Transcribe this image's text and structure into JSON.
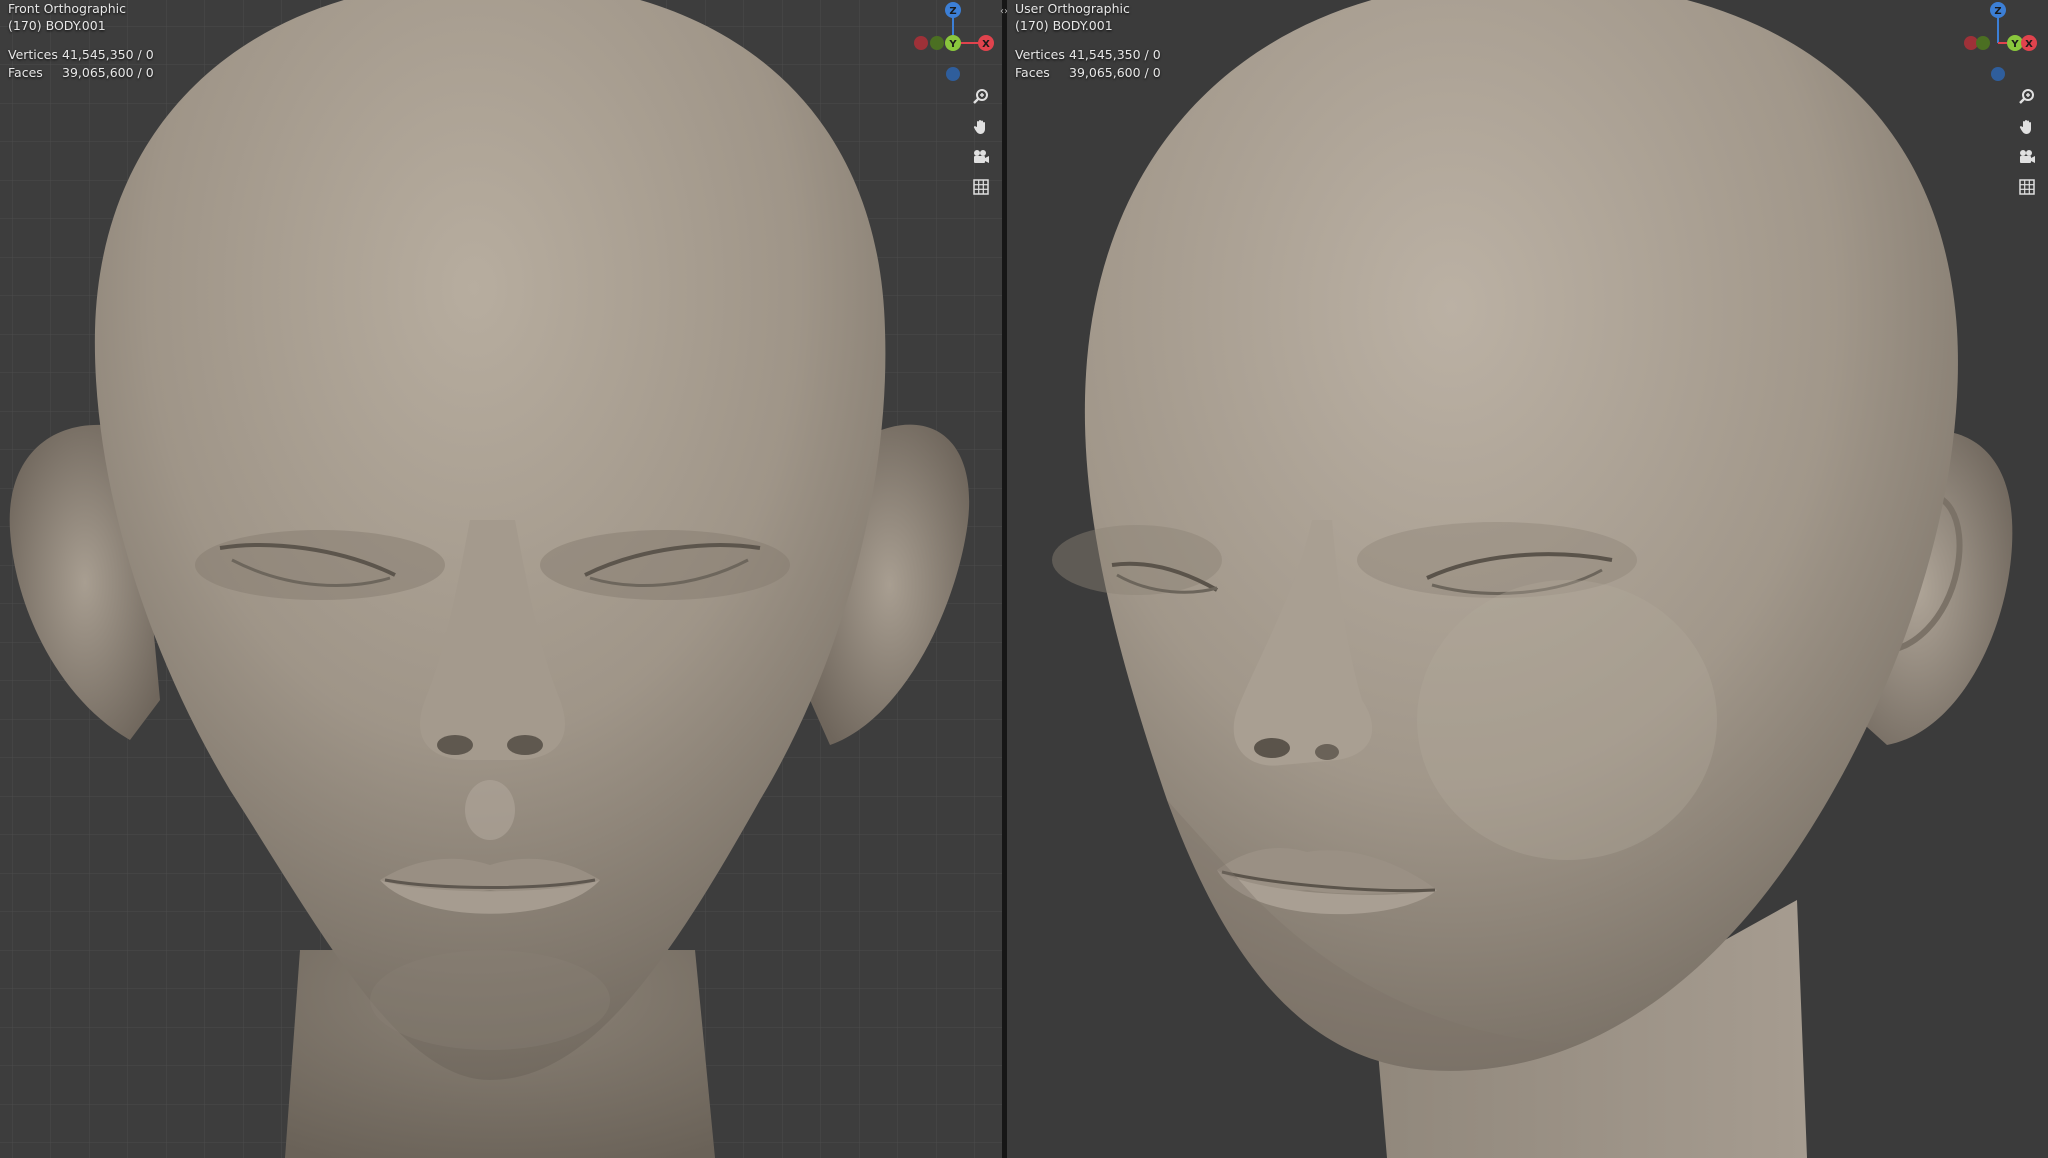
{
  "viewports": {
    "left": {
      "view_name": "Front Orthographic",
      "object_name": "(170) BODY.001",
      "stats": [
        {
          "label": "Vertices",
          "value": "41,545,350 / 0"
        },
        {
          "label": "Faces",
          "value": "39,065,600 / 0"
        }
      ],
      "gizmo_labels": {
        "z": "Z",
        "y": "Y",
        "x": "X"
      }
    },
    "right": {
      "view_name": "User Orthographic",
      "object_name": "(170) BODY.001",
      "stats": [
        {
          "label": "Vertices",
          "value": "41,545,350 / 0"
        },
        {
          "label": "Faces",
          "value": "39,065,600 / 0"
        }
      ],
      "gizmo_labels": {
        "z": "Z",
        "y": "Y",
        "x": "X"
      }
    }
  },
  "navigation_controls": [
    {
      "name": "zoom",
      "icon": "magnifier-icon"
    },
    {
      "name": "pan",
      "icon": "hand-icon"
    },
    {
      "name": "camera",
      "icon": "camera-icon"
    },
    {
      "name": "perspective-toggle",
      "icon": "grid-icon"
    }
  ],
  "colors": {
    "viewport_background": "#3d3d3d",
    "grid_line": "#4a4a4a",
    "clay": "#a49a8e",
    "axis_x": "#e0434d",
    "axis_y": "#8ac73d",
    "axis_z": "#3c7fd6"
  }
}
